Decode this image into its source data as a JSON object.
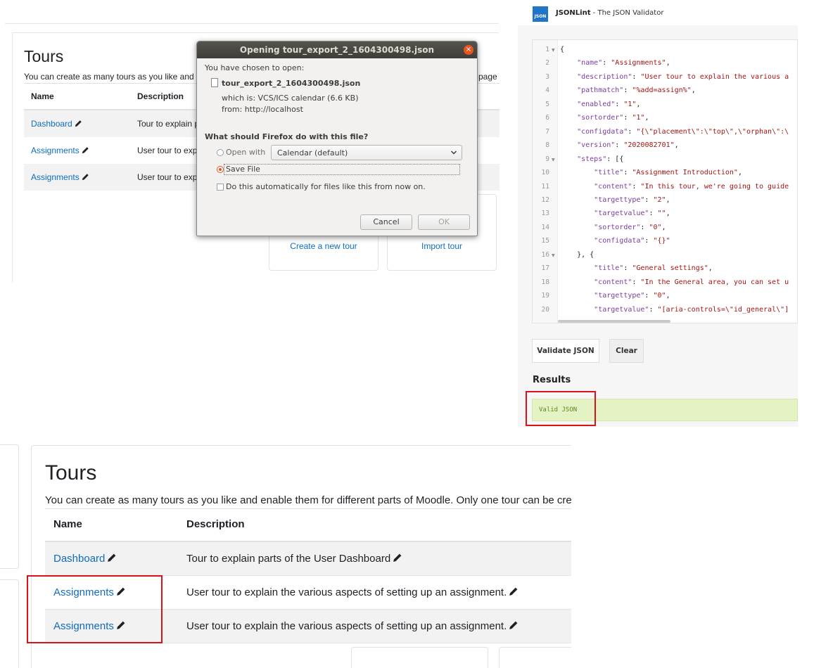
{
  "moodle_top": {
    "title": "Tours",
    "intro": "You can create as many tours as you like and",
    "intro_tail": "page",
    "columns": {
      "name": "Name",
      "description": "Description"
    },
    "rows": [
      {
        "name": "Dashboard",
        "description": "Tour to explain p"
      },
      {
        "name": "Assignments",
        "description": "User tour to exp"
      },
      {
        "name": "Assignments",
        "description": "User tour to exp"
      }
    ],
    "actions": {
      "create": "Create a new tour",
      "import": "Import tour"
    }
  },
  "firefox_dialog": {
    "title": "Opening tour_export_2_1604300498.json",
    "chosen_label": "You have chosen to open:",
    "filename": "tour_export_2_1604300498.json",
    "which_is": "which is: VCS/ICS calendar (6.6 KB)",
    "from": "from: http://localhost",
    "question": "What should Firefox do with this file?",
    "open_with_label": "Open with",
    "open_with_value": "Calendar (default)",
    "save_file_label": "Save File",
    "auto_label": "Do this automatically for files like this from now on.",
    "cancel_label": "Cancel",
    "ok_label": "OK"
  },
  "jsonlint": {
    "brand_name": "JSONLint",
    "brand_tagline": " - The JSON Validator",
    "logo_text": "JSON",
    "lines": [
      {
        "n": "1",
        "t": "{"
      },
      {
        "n": "2",
        "t": "    \"name\": \"Assignments\","
      },
      {
        "n": "3",
        "t": "    \"description\": \"User tour to explain the various a"
      },
      {
        "n": "4",
        "t": "    \"pathmatch\": \"%add=assign%\","
      },
      {
        "n": "5",
        "t": "    \"enabled\": \"1\","
      },
      {
        "n": "6",
        "t": "    \"sortorder\": \"1\","
      },
      {
        "n": "7",
        "t": "    \"configdata\": \"{\\\"placement\\\":\\\"top\\\",\\\"orphan\\\":\\"
      },
      {
        "n": "8",
        "t": "    \"version\": \"2020082701\","
      },
      {
        "n": "9",
        "t": "    \"steps\": [{"
      },
      {
        "n": "10",
        "t": "        \"title\": \"Assignment Introduction\","
      },
      {
        "n": "11",
        "t": "        \"content\": \"In this tour, we're going to guide"
      },
      {
        "n": "12",
        "t": "        \"targettype\": \"2\","
      },
      {
        "n": "13",
        "t": "        \"targetvalue\": \"\","
      },
      {
        "n": "14",
        "t": "        \"sortorder\": \"0\","
      },
      {
        "n": "15",
        "t": "        \"configdata\": \"{}\""
      },
      {
        "n": "16",
        "t": "    }, {"
      },
      {
        "n": "17",
        "t": "        \"title\": \"General settings\","
      },
      {
        "n": "18",
        "t": "        \"content\": \"In the General area, you can set u"
      },
      {
        "n": "19",
        "t": "        \"targettype\": \"0\","
      },
      {
        "n": "20",
        "t": "        \"targetvalue\": \"[aria-controls=\\\"id_general\\\"]"
      }
    ],
    "validate_label": "Validate JSON",
    "clear_label": "Clear",
    "results_title": "Results",
    "result_text": "Valid JSON"
  },
  "moodle_bottom": {
    "title": "Tours",
    "intro": "You can create as many tours as you like and enable them for different parts of Moodle. Only one tour can be cre",
    "columns": {
      "name": "Name",
      "description": "Description"
    },
    "rows": [
      {
        "name": "Dashboard",
        "description": "Tour to explain parts of the User Dashboard"
      },
      {
        "name": "Assignments",
        "description": "User tour to explain the various aspects of setting up an assignment."
      },
      {
        "name": "Assignments",
        "description": "User tour to explain the various aspects of setting up an assignment."
      }
    ]
  },
  "colors": {
    "link": "#0f6cbf",
    "highlight": "#d9121b",
    "dialog_titlebar": "#3f3d39",
    "ubuntu_orange": "#e95420",
    "valid_bg": "#e5f2c3",
    "json_string": "#a31515"
  },
  "icons": [
    "pencil-icon",
    "file-icon",
    "close-icon",
    "chevron-down-icon",
    "fold-arrow-icon",
    "json-logo"
  ]
}
